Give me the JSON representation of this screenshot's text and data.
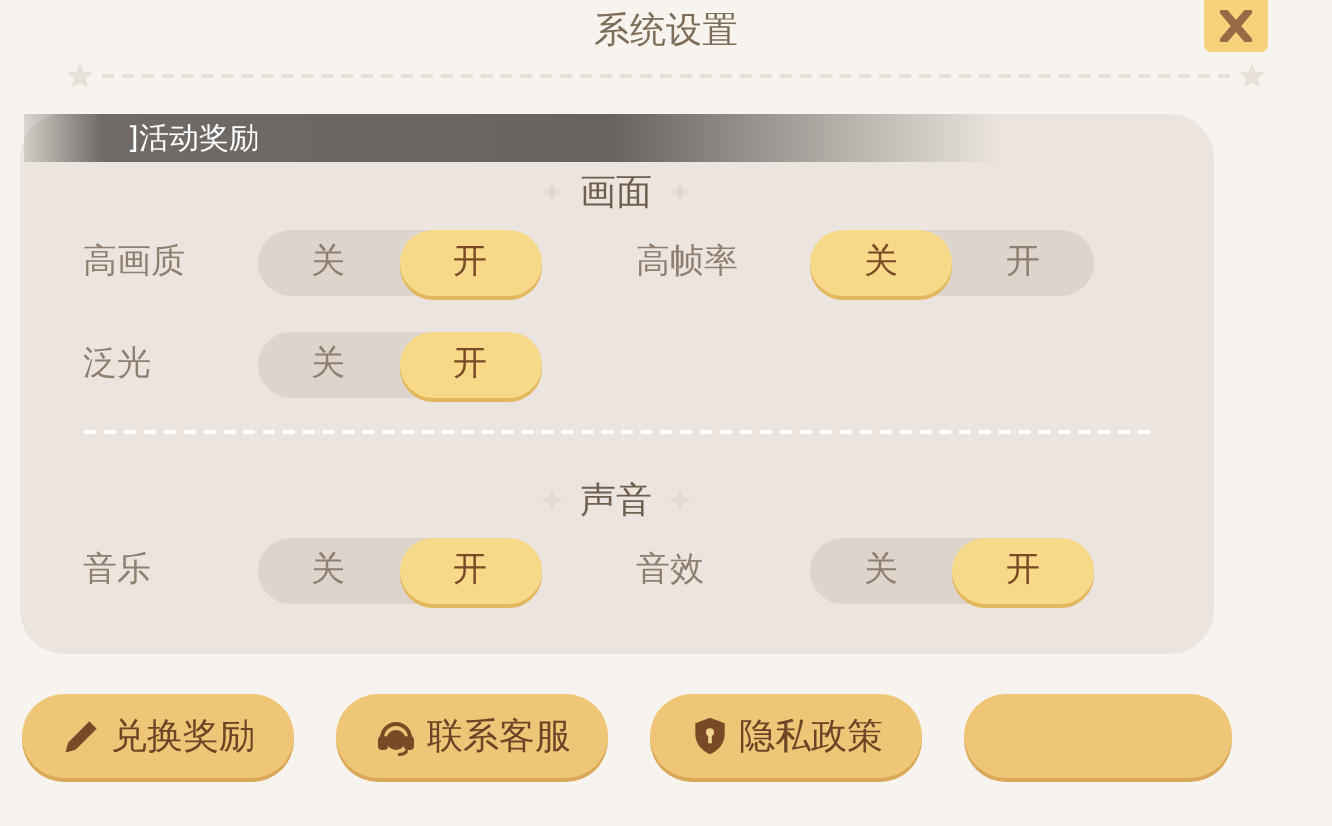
{
  "window": {
    "title": "系统设置"
  },
  "toast": "]活动奖励",
  "sections": [
    {
      "title": "画面",
      "settings": [
        {
          "label": "高画质",
          "options": [
            {
              "label": "关",
              "selected": false
            },
            {
              "label": "开",
              "selected": true
            }
          ]
        },
        {
          "label": "高帧率",
          "options": [
            {
              "label": "关",
              "selected": true
            },
            {
              "label": "开",
              "selected": false
            }
          ]
        },
        {
          "label": "泛光",
          "options": [
            {
              "label": "关",
              "selected": false
            },
            {
              "label": "开",
              "selected": true
            }
          ]
        }
      ]
    },
    {
      "title": "声音",
      "settings": [
        {
          "label": "音乐",
          "options": [
            {
              "label": "关",
              "selected": false
            },
            {
              "label": "开",
              "selected": true
            }
          ]
        },
        {
          "label": "音效",
          "options": [
            {
              "label": "关",
              "selected": false
            },
            {
              "label": "开",
              "selected": true
            }
          ]
        }
      ]
    }
  ],
  "buttons": [
    {
      "kind": "pencil",
      "label": "兑换奖励"
    },
    {
      "kind": "headset",
      "label": "联系客服"
    },
    {
      "kind": "shield",
      "label": "隐私政策"
    },
    {
      "kind": "blank"
    }
  ]
}
